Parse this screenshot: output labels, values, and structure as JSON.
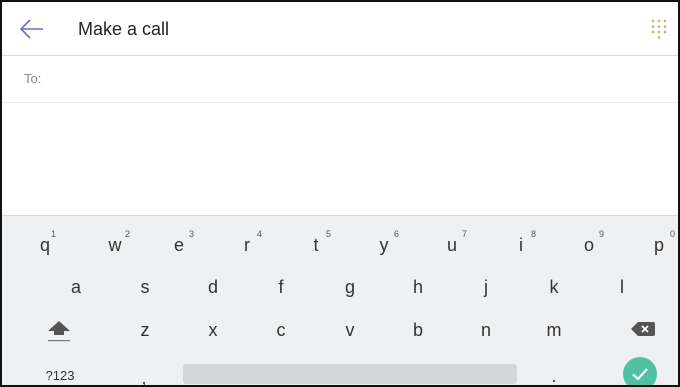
{
  "header": {
    "title": "Make a call"
  },
  "to": {
    "label": "To:",
    "value": ""
  },
  "keyboard": {
    "row1": [
      {
        "ch": "q",
        "hint": "1"
      },
      {
        "ch": "w",
        "hint": "2"
      },
      {
        "ch": "e",
        "hint": "3"
      },
      {
        "ch": "r",
        "hint": "4"
      },
      {
        "ch": "t",
        "hint": "5"
      },
      {
        "ch": "y",
        "hint": "6"
      },
      {
        "ch": "u",
        "hint": "7"
      },
      {
        "ch": "i",
        "hint": "8"
      },
      {
        "ch": "o",
        "hint": "9"
      },
      {
        "ch": "p",
        "hint": "0"
      }
    ],
    "row2": [
      "a",
      "s",
      "d",
      "f",
      "g",
      "h",
      "j",
      "k",
      "l"
    ],
    "row3": [
      "z",
      "x",
      "c",
      "v",
      "b",
      "n",
      "m"
    ],
    "symbols_label": "?123",
    "comma": ",",
    "period": "."
  },
  "colors": {
    "accent": "#4fc3a1",
    "back_arrow": "#6b6bd6",
    "dialpad": "#c9b15a"
  },
  "icons": {
    "back": "back-arrow-icon",
    "dialpad": "dialpad-icon",
    "shift": "shift-icon",
    "backspace": "backspace-icon",
    "enter": "checkmark-icon"
  }
}
